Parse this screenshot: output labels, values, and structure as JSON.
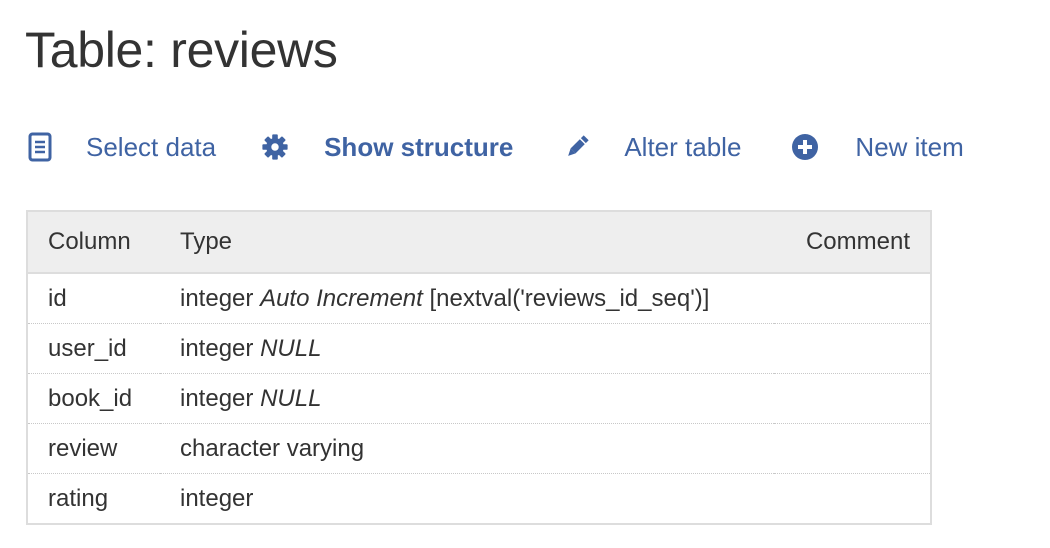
{
  "page": {
    "title": "Table: reviews"
  },
  "toolbar": {
    "items": [
      {
        "label": "Select data",
        "icon": "document-icon"
      },
      {
        "label": "Show structure",
        "icon": "gear-icon"
      },
      {
        "label": "Alter table",
        "icon": "pencil-icon"
      },
      {
        "label": "New item",
        "icon": "plus-circle-icon"
      }
    ]
  },
  "structure": {
    "headers": {
      "column": "Column",
      "type": "Type",
      "comment": "Comment"
    },
    "rows": [
      {
        "column": "id",
        "type": "integer",
        "modifier": "Auto Increment",
        "extra": "[nextval('reviews_id_seq')]",
        "comment": ""
      },
      {
        "column": "user_id",
        "type": "integer",
        "modifier": "NULL",
        "extra": "",
        "comment": ""
      },
      {
        "column": "book_id",
        "type": "integer",
        "modifier": "NULL",
        "extra": "",
        "comment": ""
      },
      {
        "column": "review",
        "type": "character varying",
        "modifier": "",
        "extra": "",
        "comment": ""
      },
      {
        "column": "rating",
        "type": "integer",
        "modifier": "",
        "extra": "",
        "comment": ""
      }
    ]
  },
  "colors": {
    "link": "#3f63a3",
    "text": "#333333",
    "header_bg": "#eeeeee",
    "border": "#dddddd"
  }
}
